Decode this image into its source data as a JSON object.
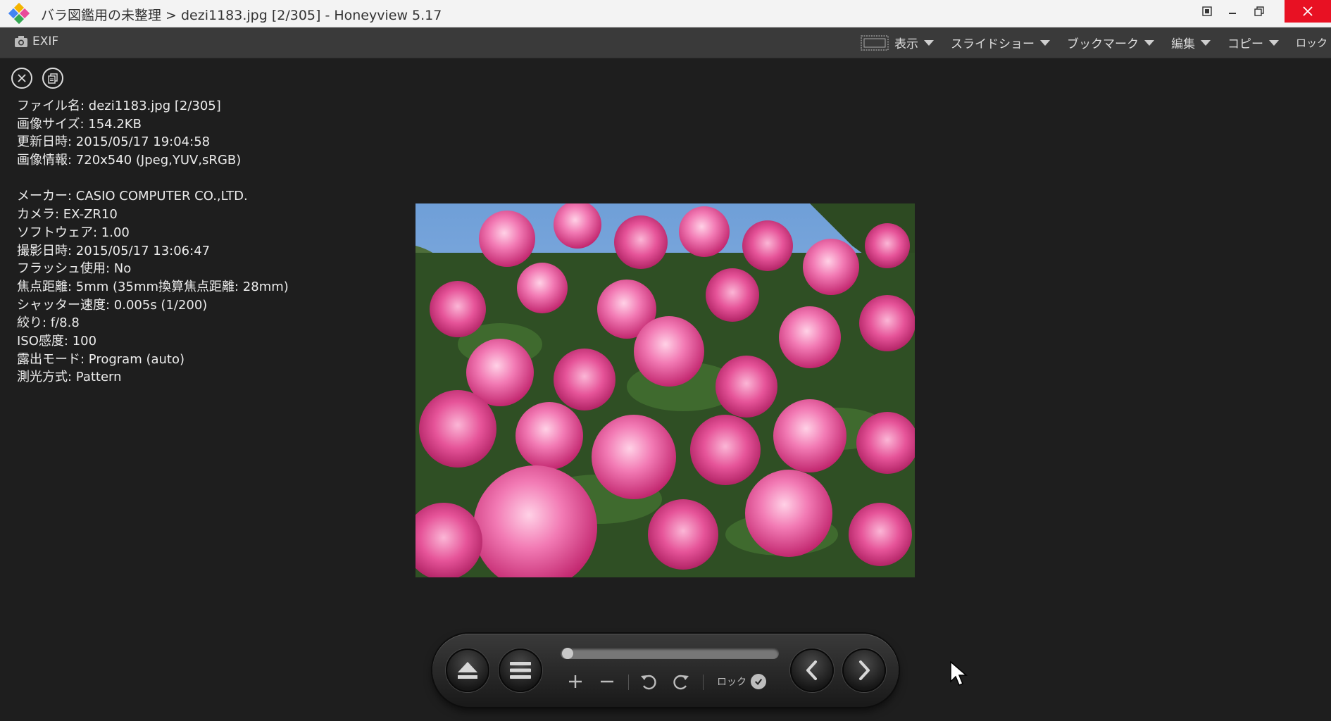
{
  "window": {
    "title": "バラ図鑑用の未整理 > dezi1183.jpg [2/305] - Honeyview 5.17"
  },
  "toolbar": {
    "exif_label": "EXIF",
    "menu": [
      {
        "label": "表示",
        "icon": "fullscreen-frame-icon"
      },
      {
        "label": "スライドショー"
      },
      {
        "label": "ブックマーク"
      },
      {
        "label": "編集"
      },
      {
        "label": "コピー"
      }
    ],
    "lock_label": "ロック"
  },
  "exif": {
    "rows": [
      "ファイル名: dezi1183.jpg [2/305]",
      "画像サイズ: 154.2KB",
      "更新日時: 2015/05/17 19:04:58",
      "画像情報: 720x540 (Jpeg,YUV,sRGB)",
      "",
      "メーカー: CASIO COMPUTER CO.,LTD.",
      "カメラ: EX-ZR10",
      "ソフトウェア: 1.00",
      "撮影日時: 2015/05/17 13:06:47",
      "フラッシュ使用: No",
      "焦点距離: 5mm (35mm換算焦点距離: 28mm)",
      "シャッター速度: 0.005s (1/200)",
      "絞り: f/8.8",
      "ISO感度: 100",
      "露出モード: Program (auto)",
      "測光方式: Pattern"
    ]
  },
  "controller": {
    "lock_label": "ロック",
    "seek_position": 0.0
  },
  "colors": {
    "background": "#1e1e1e",
    "toolbar": "#3a3a3a",
    "titlebar": "#f3f3f3",
    "close": "#e81123",
    "rose": "#e8559a"
  }
}
